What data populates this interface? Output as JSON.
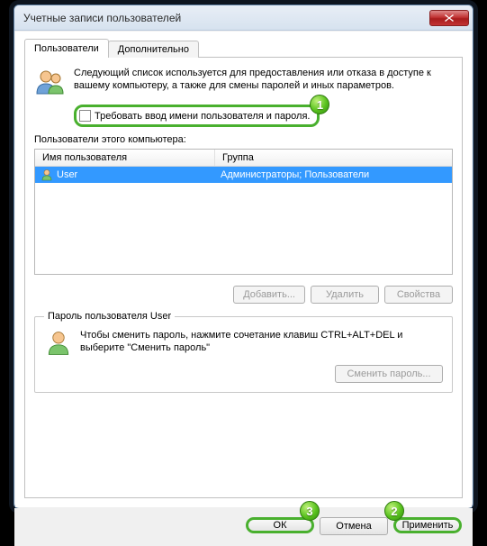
{
  "window": {
    "title": "Учетные записи пользователей"
  },
  "tabs": {
    "users": "Пользователи",
    "advanced": "Дополнительно"
  },
  "intro": "Следующий список используется для предоставления или отказа в доступе к вашему компьютеру, а также для смены паролей и иных параметров.",
  "require_checkbox_label": "Требовать ввод имени пользователя и пароля.",
  "users_of_computer": "Пользователи этого компьютера:",
  "columns": {
    "username": "Имя пользователя",
    "group": "Группа"
  },
  "rows": [
    {
      "username": "User",
      "group": "Администраторы; Пользователи"
    }
  ],
  "buttons": {
    "add": "Добавить...",
    "remove": "Удалить",
    "properties": "Свойства",
    "change_password": "Сменить пароль...",
    "ok": "ОК",
    "cancel": "Отмена",
    "apply": "Применить"
  },
  "password_group": {
    "legend": "Пароль пользователя User",
    "text": "Чтобы сменить пароль, нажмите сочетание клавиш CTRL+ALT+DEL и выберите \"Сменить пароль\""
  },
  "badges": {
    "b1": "1",
    "b2": "2",
    "b3": "3"
  }
}
